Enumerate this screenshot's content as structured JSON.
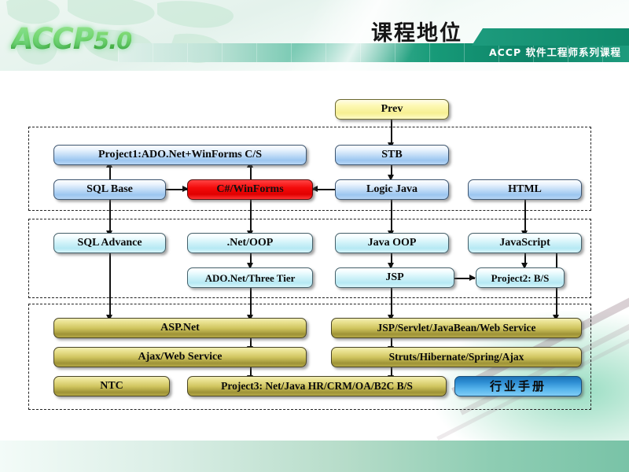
{
  "header": {
    "logo_text": "ACCP",
    "logo_version": "5.0",
    "title": "课程地位",
    "subtitle": "ACCP 软件工程师系列课程"
  },
  "diagram": {
    "top_node": {
      "label": "Prev",
      "style": "yellow"
    },
    "groups": [
      {
        "name": "stage-one"
      },
      {
        "name": "stage-two"
      },
      {
        "name": "stage-three"
      }
    ],
    "nodes": [
      {
        "id": "prev",
        "label": "Prev"
      },
      {
        "id": "project1",
        "label": "Project1:ADO.Net+WinForms C/S"
      },
      {
        "id": "stb",
        "label": "STB"
      },
      {
        "id": "sqlbase",
        "label": "SQL Base"
      },
      {
        "id": "csharp",
        "label": "C#/WinForms"
      },
      {
        "id": "logicjava",
        "label": "Logic Java"
      },
      {
        "id": "html",
        "label": "HTML"
      },
      {
        "id": "sqladv",
        "label": "SQL Advance"
      },
      {
        "id": "netoop",
        "label": ".Net/OOP"
      },
      {
        "id": "javaoop",
        "label": "Java OOP"
      },
      {
        "id": "javascript",
        "label": "JavaScript"
      },
      {
        "id": "adonet",
        "label": "ADO.Net/Three Tier"
      },
      {
        "id": "jsp",
        "label": "JSP"
      },
      {
        "id": "project2",
        "label": "Project2: B/S"
      },
      {
        "id": "aspnet",
        "label": "ASP.Net"
      },
      {
        "id": "jsvcs",
        "label": "JSP/Servlet/JavaBean/Web Service"
      },
      {
        "id": "ajaxws",
        "label": "Ajax/Web Service"
      },
      {
        "id": "struts",
        "label": "Struts/Hibernate/Spring/Ajax"
      },
      {
        "id": "ntc",
        "label": "NTC"
      },
      {
        "id": "project3",
        "label": "Project3: Net/Java HR/CRM/OA/B2C B/S"
      },
      {
        "id": "handbook",
        "label": "行业手册"
      }
    ],
    "colors": {
      "blue": "#9cc6f0",
      "cyan": "#b6e9f4",
      "olive": "#cfc45e",
      "yellow": "#f6ef92",
      "red": "#e00000",
      "cta_blue": "#2f8fd4",
      "brand_green": "#179a78"
    }
  }
}
